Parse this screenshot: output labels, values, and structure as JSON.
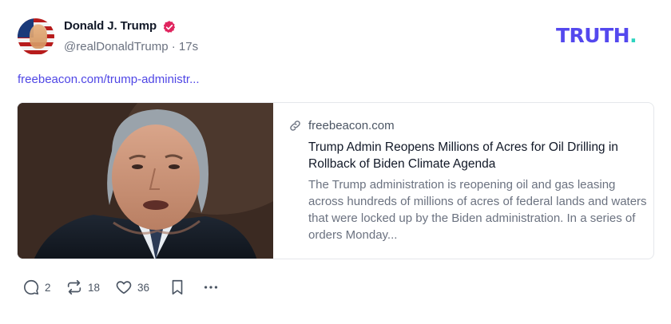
{
  "post": {
    "author_name": "Donald J. Trump",
    "handle": "@realDonaldTrump",
    "separator": "·",
    "time": "17s",
    "link_text": "freebeacon.com/trump-administr..."
  },
  "brand": {
    "text": "TRUTH",
    "dot": "."
  },
  "card": {
    "domain": "freebeacon.com",
    "title": "Trump Admin Reopens Millions of Acres for Oil Drilling in Rollback of Biden Climate Agenda",
    "description": "The Trump administration is reopening oil and gas leasing across hundreds of millions of acres of federal lands and waters that were locked up by the Biden administration. In a series of orders Monday..."
  },
  "actions": {
    "replies": "2",
    "reposts": "18",
    "likes": "36"
  },
  "colors": {
    "brand": "#5448ee",
    "brand_dot": "#2dd4bf",
    "link": "#4f46e5",
    "verified": "#e0245e"
  },
  "icons": {
    "verified": "verified-badge-icon",
    "link": "link-icon",
    "reply": "comment-icon",
    "repost": "repost-icon",
    "like": "heart-icon",
    "bookmark": "bookmark-icon",
    "more": "more-dots-icon"
  }
}
